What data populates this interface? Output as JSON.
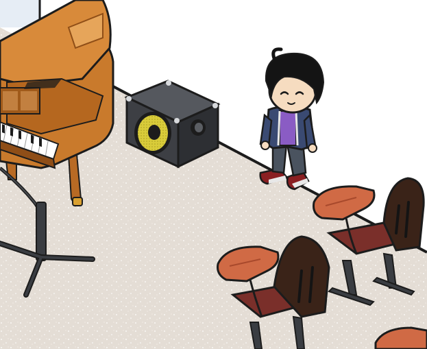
{
  "scene": {
    "type": "isometric-room",
    "palette": {
      "wall": "#ffffff",
      "window": "#e6edf5",
      "floor": "#e4ddd5",
      "floor_speckle": "#ffffff",
      "outline": "#1c1c1c",
      "piano_wood": "#c97a2c",
      "piano_wood_dark": "#8f4e17",
      "speaker_body": "#3d3f44",
      "speaker_cone": "#d9cc3a",
      "desk_top": "#d06a45",
      "chair_back": "#3a2318",
      "chair_seat": "#7a2f2a",
      "metal": "#3a3d42",
      "avatar_hair": "#141414",
      "avatar_skin": "#f6dcc0",
      "avatar_jacket": "#3a4a72",
      "avatar_shirt": "#8a5cc4",
      "avatar_pants": "#4a535f",
      "avatar_shoes": "#8a1f22"
    },
    "objects": [
      {
        "kind": "grand-piano",
        "icon": "piano-icon"
      },
      {
        "kind": "microphone-stand",
        "icon": "mic-stand-icon"
      },
      {
        "kind": "bass-amplifier-speaker",
        "icon": "speaker-icon"
      },
      {
        "kind": "avatar",
        "icon": "avatar-icon",
        "state": "smiling, standing"
      },
      {
        "kind": "student-desk-chair",
        "icon": "desk-chair-icon",
        "count": 3
      }
    ]
  }
}
